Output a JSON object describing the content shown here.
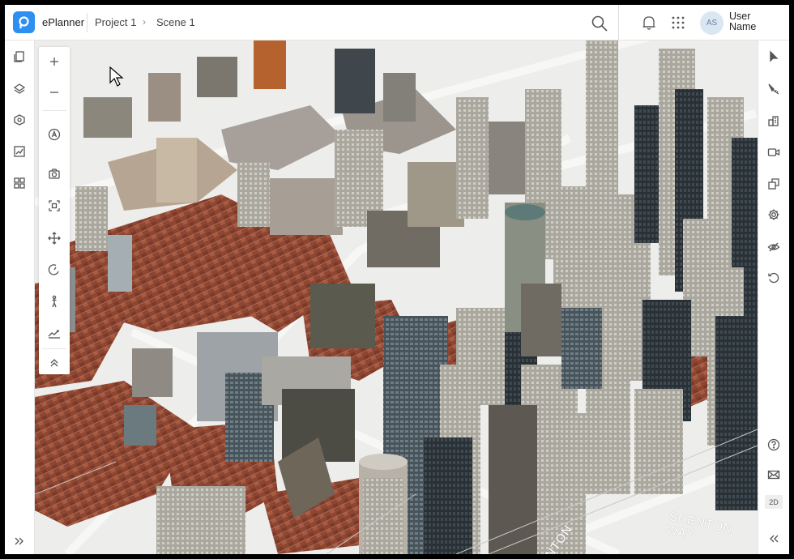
{
  "header": {
    "app_name": "ePlanner",
    "breadcrumb": [
      "Project 1",
      "Scene 1"
    ],
    "user": {
      "initials": "AS",
      "name": "User\nName"
    }
  },
  "map": {
    "street_labels": [
      "SHENTON WAY",
      "NTON"
    ]
  },
  "tool_panel": {
    "buttons": [
      "zoom-in",
      "zoom-out",
      "annotation",
      "screenshot",
      "fit-view",
      "pan",
      "compass",
      "pedestrian",
      "elevation",
      "collapse"
    ]
  },
  "left_rail": {
    "items": [
      "pages",
      "layers",
      "objects",
      "analysis",
      "qr-code"
    ],
    "expand_icon": "chevron-double-right"
  },
  "right_rail": {
    "items": [
      "select",
      "measure",
      "buildings",
      "camera",
      "copy",
      "settings",
      "visibility",
      "reset",
      "help",
      "mail"
    ],
    "mode_label": "2D",
    "collapse_icon": "chevron-double-left"
  },
  "colors": {
    "brand": "#2d8ff0",
    "rooftops": "#9a4c34",
    "glass": "#3a4650"
  }
}
